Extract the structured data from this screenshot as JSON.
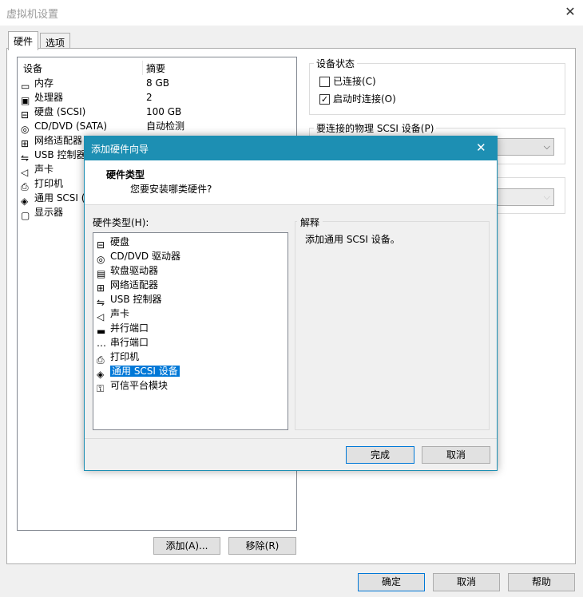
{
  "window": {
    "title": "虚拟机设置",
    "close_glyph": "✕"
  },
  "tabs": [
    {
      "label": "硬件"
    },
    {
      "label": "选项"
    }
  ],
  "devices": {
    "headers": {
      "device": "设备",
      "summary": "摘要"
    },
    "items": [
      {
        "icon": "memory-icon",
        "name": "内存",
        "summary": "8 GB"
      },
      {
        "icon": "cpu-icon",
        "name": "处理器",
        "summary": "2"
      },
      {
        "icon": "harddisk-icon",
        "name": "硬盘 (SCSI)",
        "summary": "100 GB"
      },
      {
        "icon": "cd-dvd-icon",
        "name": "CD/DVD (SATA)",
        "summary": "自动检测"
      },
      {
        "icon": "network-adapter-icon",
        "name": "网络适配器",
        "summary": ""
      },
      {
        "icon": "usb-icon",
        "name": "USB 控制器",
        "summary": ""
      },
      {
        "icon": "sound-icon",
        "name": "声卡",
        "summary": ""
      },
      {
        "icon": "printer-icon",
        "name": "打印机",
        "summary": ""
      },
      {
        "icon": "scsi-icon",
        "name": "通用 SCSI (",
        "summary": ""
      },
      {
        "icon": "display-icon",
        "name": "显示器",
        "summary": ""
      }
    ]
  },
  "buttons": {
    "add": "添加(A)...",
    "remove": "移除(R)",
    "ok": "确定",
    "cancel": "取消",
    "help": "帮助"
  },
  "device_status": {
    "title": "设备状态",
    "connected": {
      "label": "已连接(C)",
      "checked": false
    },
    "connect_at_power_on": {
      "label": "启动时连接(O)",
      "checked": true
    }
  },
  "physical_scsi": {
    "title": "要连接的物理 SCSI 设备(P)",
    "value": ""
  },
  "wizard": {
    "title": "添加硬件向导",
    "close_glyph": "✕",
    "heading": "硬件类型",
    "subheading": "您要安装哪类硬件?",
    "list_label": "硬件类型(H):",
    "items": [
      {
        "icon": "harddisk-icon",
        "label": "硬盘"
      },
      {
        "icon": "cd-dvd-icon",
        "label": "CD/DVD 驱动器"
      },
      {
        "icon": "floppy-icon",
        "label": "软盘驱动器"
      },
      {
        "icon": "network-adapter-icon",
        "label": "网络适配器"
      },
      {
        "icon": "usb-icon",
        "label": "USB 控制器"
      },
      {
        "icon": "sound-icon",
        "label": "声卡"
      },
      {
        "icon": "parallel-port-icon",
        "label": "并行端口"
      },
      {
        "icon": "serial-port-icon",
        "label": "串行端口"
      },
      {
        "icon": "printer-icon",
        "label": "打印机"
      },
      {
        "icon": "scsi-icon",
        "label": "通用 SCSI 设备",
        "selected": true
      },
      {
        "icon": "tpm-icon",
        "label": "可信平台模块"
      }
    ],
    "explanation_title": "解释",
    "explanation_text": "添加通用 SCSI 设备。",
    "finish": "完成",
    "cancel": "取消"
  },
  "colors": {
    "accent": "#1d8fb3",
    "selection": "#0078d7"
  }
}
